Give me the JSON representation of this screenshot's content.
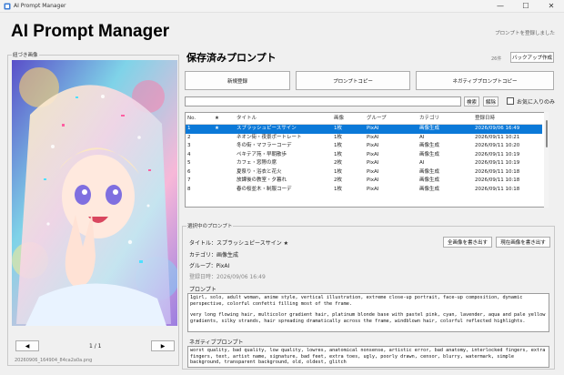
{
  "window": {
    "title": "AI Prompt Manager",
    "minimize": "—",
    "maximize": "☐",
    "close": "✕"
  },
  "app_title": "AI Prompt Manager",
  "status_message": "プロンプトを登録しました",
  "left_panel": {
    "group_label": "紐づき画像",
    "page_indicator": "1 / 1",
    "prev": "◀",
    "next": "▶",
    "filename": "20260906_164904_84ca2a0a.png"
  },
  "prompts": {
    "section_title": "保存済みプロンプト",
    "count": "26件",
    "backup_label": "バックアップ作成",
    "buttons": {
      "new": "新規登録",
      "copy_prompt": "プロンプトコピー",
      "copy_negative": "ネガティブプロンプトコピー"
    },
    "search": {
      "value": "",
      "button": "検索",
      "clear": "解除",
      "favorites_only": "お気に入りのみ"
    },
    "columns": [
      "No.",
      "★",
      "タイトル",
      "画像",
      "グループ",
      "カテゴリ",
      "登録日時"
    ],
    "rows": [
      {
        "no": "1",
        "fav": "★",
        "title": "スプラッシュピースサイン",
        "images": "1枚",
        "group": "PixAI",
        "category": "画像生成",
        "date": "2026/09/06 16:49",
        "selected": true
      },
      {
        "no": "2",
        "fav": "",
        "title": "ネオン街・夜景ポートレート",
        "images": "1枚",
        "group": "PixAI",
        "category": "AI",
        "date": "2026/09/11 10:21",
        "selected": false
      },
      {
        "no": "3",
        "fav": "",
        "title": "冬の街・マフラーコーデ",
        "images": "1枚",
        "group": "PixAI",
        "category": "画像生成",
        "date": "2026/09/11 10:20",
        "selected": false
      },
      {
        "no": "4",
        "fav": "",
        "title": "ペキテア苑・早朝散歩",
        "images": "1枚",
        "group": "PixAI",
        "category": "画像生成",
        "date": "2026/09/11 10:19",
        "selected": false
      },
      {
        "no": "5",
        "fav": "",
        "title": "カフェ・窓際の席",
        "images": "2枚",
        "group": "PixAI",
        "category": "AI",
        "date": "2026/09/11 10:19",
        "selected": false
      },
      {
        "no": "6",
        "fav": "",
        "title": "夏祭り・浴衣と花火",
        "images": "1枚",
        "group": "PixAI",
        "category": "画像生成",
        "date": "2026/09/11 10:18",
        "selected": false
      },
      {
        "no": "7",
        "fav": "",
        "title": "放課後の教室・夕暮れ",
        "images": "2枚",
        "group": "PixAI",
        "category": "画像生成",
        "date": "2026/09/11 10:18",
        "selected": false
      },
      {
        "no": "8",
        "fav": "",
        "title": "春の桜並木・制服コーデ",
        "images": "1枚",
        "group": "PixAI",
        "category": "画像生成",
        "date": "2026/09/11 10:18",
        "selected": false
      }
    ]
  },
  "selected_prompt": {
    "group_label": "選択中のプロンプト",
    "title_line": "タイトル：スプラッシュピースサイン ★",
    "category_line": "カテゴリ：画像生成",
    "group_line": "グループ：PixAI",
    "date_line": "登録日時：2026/09/06 16:49",
    "overwrite_button": "全画像を書き出す",
    "export_current_button": "現在画像を書き出す",
    "prompt_label": "プロンプト",
    "prompt_text_1": "1girl, solo, adult woman, anime style, vertical illustration, extreme close-up portrait, face-up composition, dynamic perspective, colorful confetti filling most of the frame.",
    "prompt_text_2": "very long flowing hair, multicolor gradient hair, platinum blonde base with pastel pink, cyan, lavender, aqua and pale yellow gradients, silky strands, hair spreading dramatically across the frame, windblown hair, colorful reflected highlights.",
    "negative_label": "ネガティブプロンプト",
    "negative_text": "worst quality, bad quality, low quality, lowres, anatomical nonsense, artistic error, bad anatomy, interlocked fingers, extra fingers, text, artist name, signature, bad feet, extra toes, ugly, poorly drawn, censor, blurry, watermark, simple background, transparent background, old, oldest, glitch"
  },
  "colors": {
    "selection": "#0b79d8",
    "window_bg": "#f0f0f0"
  }
}
